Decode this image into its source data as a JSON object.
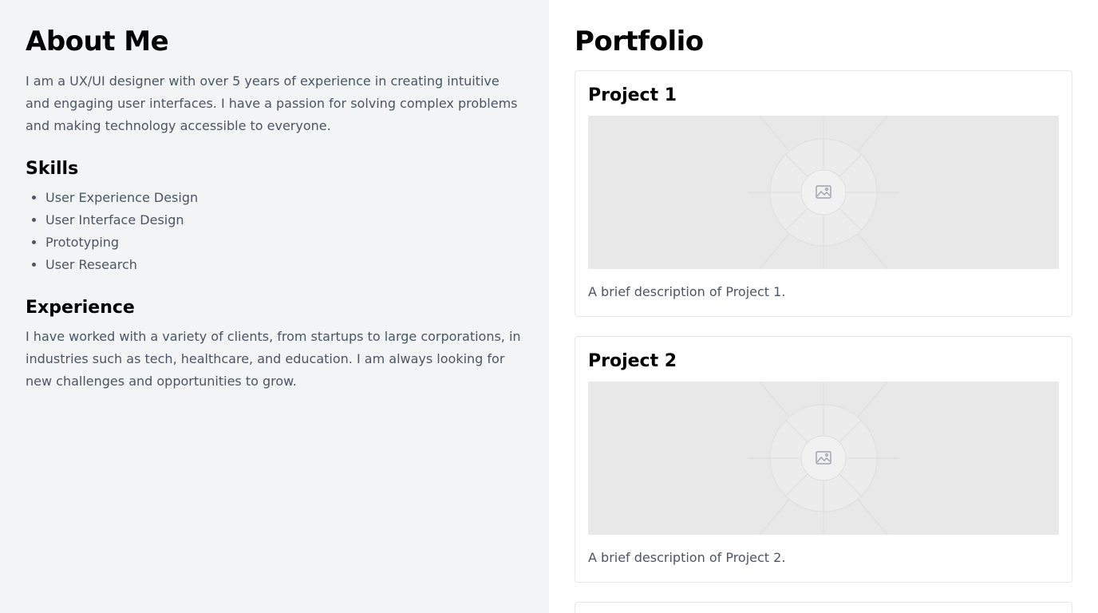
{
  "about": {
    "title": "About Me",
    "intro": "I am a UX/UI designer with over 5 years of experience in creating intuitive and engaging user interfaces. I have a passion for solving complex problems and making technology accessible to everyone.",
    "skills_heading": "Skills",
    "skills": [
      "User Experience Design",
      "User Interface Design",
      "Prototyping",
      "User Research"
    ],
    "experience_heading": "Experience",
    "experience_text": "I have worked with a variety of clients, from startups to large corporations, in industries such as tech, healthcare, and education. I am always looking for new challenges and opportunities to grow."
  },
  "portfolio": {
    "title": "Portfolio",
    "projects": [
      {
        "title": "Project 1",
        "image_icon": "image-placeholder-icon",
        "description": "A brief description of Project 1."
      },
      {
        "title": "Project 2",
        "image_icon": "image-placeholder-icon",
        "description": "A brief description of Project 2."
      }
    ]
  },
  "colors": {
    "left_background": "#f3f4f6",
    "body_text": "#4b5563",
    "card_border": "#e5e7eb",
    "placeholder_bg": "#e8e8e8"
  }
}
